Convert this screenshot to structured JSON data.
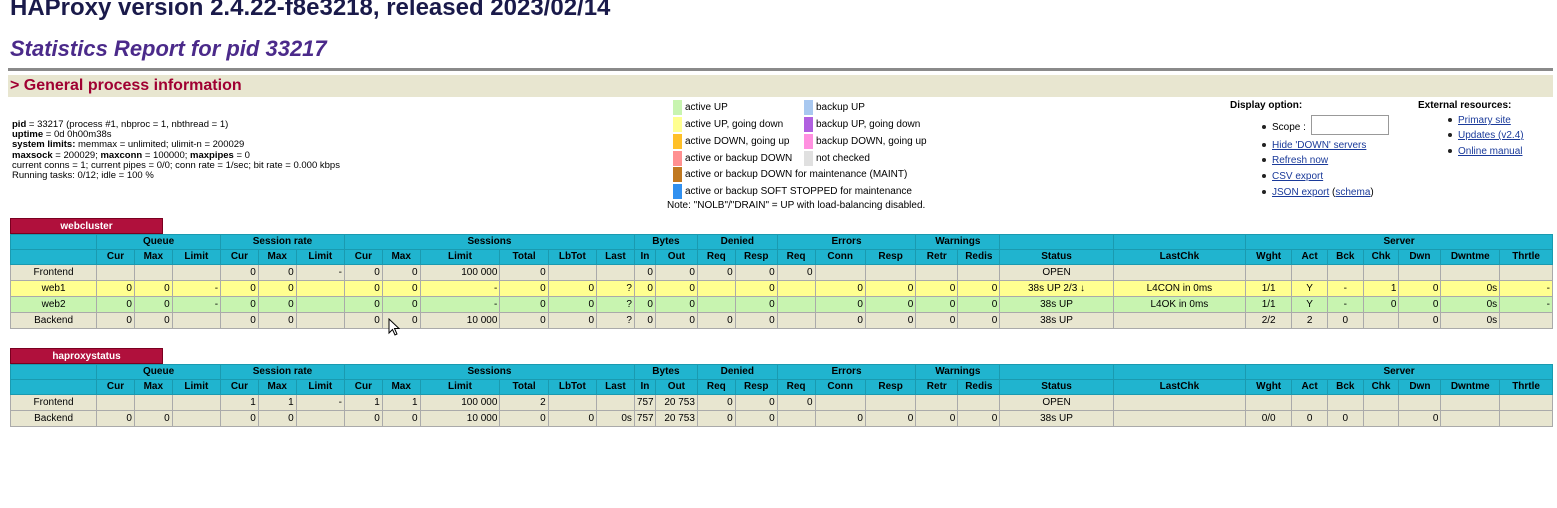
{
  "header": {
    "version_title": "HAProxy version 2.4.22-f8e3218, released 2023/02/14",
    "report_title": "Statistics Report for pid 33217",
    "section_title": "> General process information"
  },
  "process_info": {
    "lines": [
      {
        "k": "pid",
        "v": " = 33217 (process #1, nbproc = 1, nbthread = 1)"
      },
      {
        "k": "uptime",
        "v": " = 0d 0h00m38s"
      },
      {
        "k": "system limits:",
        "v": " memmax = unlimited; ulimit-n = 200029"
      },
      {
        "k": "maxsock",
        "v": " = 200029; "
      },
      {
        "k": "",
        "v": "current conns = 1; current pipes = 0/0; conn rate = 1/sec; bit rate = 0.000 kbps"
      },
      {
        "k": "",
        "v": "Running tasks: 0/12; idle = 100 %"
      }
    ],
    "maxconn_label": "maxconn",
    "maxconn_value": " = 100000; ",
    "maxpipes_label": "maxpipes",
    "maxpipes_value": " = 0"
  },
  "legend": {
    "items": [
      {
        "label": "active UP",
        "color": "#c8f4b0"
      },
      {
        "label": "active UP, going down",
        "color": "#ffff90"
      },
      {
        "label": "active DOWN, going up",
        "color": "#ffc028"
      },
      {
        "label": "active or backup DOWN",
        "color": "#ff9090"
      },
      {
        "label": "active or backup DOWN for maintenance (MAINT)",
        "color": "#c07820"
      },
      {
        "label": "active or backup SOFT STOPPED for maintenance",
        "color": "#3090f0"
      },
      {
        "label": "backup UP",
        "color": "#a8c8f0"
      },
      {
        "label": "backup UP, going down",
        "color": "#b060e0"
      },
      {
        "label": "backup DOWN, going up",
        "color": "#ff90e0"
      },
      {
        "label": "not checked",
        "color": "#e0e0e0"
      }
    ],
    "note": "Note: \"NOLB\"/\"DRAIN\" = UP with load-balancing disabled."
  },
  "display_option": {
    "title": "Display option:",
    "scope_label": "Scope :",
    "scope_value": "",
    "hide_down": "Hide 'DOWN' servers",
    "refresh": "Refresh now",
    "csv": "CSV export",
    "json": "JSON export",
    "schema": "schema"
  },
  "external": {
    "title": "External resources:",
    "primary": "Primary site",
    "updates": "Updates (v2.4)",
    "manual": "Online manual"
  },
  "groups": [
    "",
    "Queue",
    "Session rate",
    "Sessions",
    "Bytes",
    "Denied",
    "Errors",
    "Warnings",
    "",
    "",
    "Server"
  ],
  "columns": [
    "",
    "Cur",
    "Max",
    "Limit",
    "Cur",
    "Max",
    "Limit",
    "Cur",
    "Max",
    "Limit",
    "Total",
    "LbTot",
    "Last",
    "In",
    "Out",
    "Req",
    "Resp",
    "Req",
    "Conn",
    "Resp",
    "Retr",
    "Redis",
    "Status",
    "LastChk",
    "Wght",
    "Act",
    "Bck",
    "Chk",
    "Dwn",
    "Dwntme",
    "Thrtle"
  ],
  "proxies": [
    {
      "name": "webcluster",
      "rows": [
        {
          "cls": "front",
          "cells": [
            "Frontend",
            "",
            "",
            "",
            "0",
            "0",
            "-",
            "0",
            "0",
            "100 000",
            "0",
            "",
            "",
            "0",
            "0",
            "0",
            "0",
            "0",
            "",
            "",
            "",
            "",
            "OPEN",
            "",
            "",
            "",
            "",
            "",
            "",
            "",
            ""
          ]
        },
        {
          "cls": "up23",
          "cells": [
            "web1",
            "0",
            "0",
            "-",
            "0",
            "0",
            "",
            "0",
            "0",
            "-",
            "0",
            "0",
            "?",
            "0",
            "0",
            "",
            "0",
            "",
            "0",
            "0",
            "0",
            "0",
            "38s UP 2/3 ↓",
            "L4CON in 0ms",
            "1/1",
            "Y",
            "-",
            "1",
            "0",
            "0s",
            "-"
          ]
        },
        {
          "cls": "up",
          "cells": [
            "web2",
            "0",
            "0",
            "-",
            "0",
            "0",
            "",
            "0",
            "0",
            "-",
            "0",
            "0",
            "?",
            "0",
            "0",
            "",
            "0",
            "",
            "0",
            "0",
            "0",
            "0",
            "38s UP",
            "L4OK in 0ms",
            "1/1",
            "Y",
            "-",
            "0",
            "0",
            "0s",
            "-"
          ]
        },
        {
          "cls": "back",
          "cells": [
            "Backend",
            "0",
            "0",
            "",
            "0",
            "0",
            "",
            "0",
            "0",
            "10 000",
            "0",
            "0",
            "?",
            "0",
            "0",
            "0",
            "0",
            "",
            "0",
            "0",
            "0",
            "0",
            "38s UP",
            "",
            "2/2",
            "2",
            "0",
            "",
            "0",
            "0s",
            ""
          ]
        }
      ]
    },
    {
      "name": "haproxystatus",
      "rows": [
        {
          "cls": "front",
          "cells": [
            "Frontend",
            "",
            "",
            "",
            "1",
            "1",
            "-",
            "1",
            "1",
            "100 000",
            "2",
            "",
            "",
            "757",
            "20 753",
            "0",
            "0",
            "0",
            "",
            "",
            "",
            "",
            "OPEN",
            "",
            "",
            "",
            "",
            "",
            "",
            "",
            ""
          ]
        },
        {
          "cls": "back",
          "cells": [
            "Backend",
            "0",
            "0",
            "",
            "0",
            "0",
            "",
            "0",
            "0",
            "10 000",
            "0",
            "0",
            "0s",
            "757",
            "20 753",
            "0",
            "0",
            "",
            "0",
            "0",
            "0",
            "0",
            "38s UP",
            "",
            "0/0",
            "0",
            "0",
            "",
            "0",
            "",
            ""
          ]
        }
      ]
    }
  ]
}
